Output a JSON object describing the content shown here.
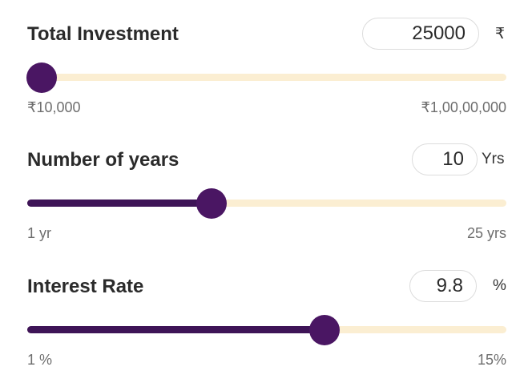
{
  "investment": {
    "label": "Total Investment",
    "value": "25000",
    "unit": "₹",
    "min_label": "₹10,000",
    "max_label": "₹1,00,00,000",
    "slider_fraction": 0.03
  },
  "years": {
    "label": "Number of years",
    "value": "10",
    "unit": "Yrs",
    "min_label": "1 yr",
    "max_label": "25 yrs",
    "slider_fraction": 0.385
  },
  "interest": {
    "label": "Interest Rate",
    "value": "9.8",
    "unit": "%",
    "min_label": "1 %",
    "max_label": "15%",
    "slider_fraction": 0.62
  },
  "colors": {
    "track": "#fbeed2",
    "fill": "#3e1457",
    "thumb": "#4a1663"
  }
}
